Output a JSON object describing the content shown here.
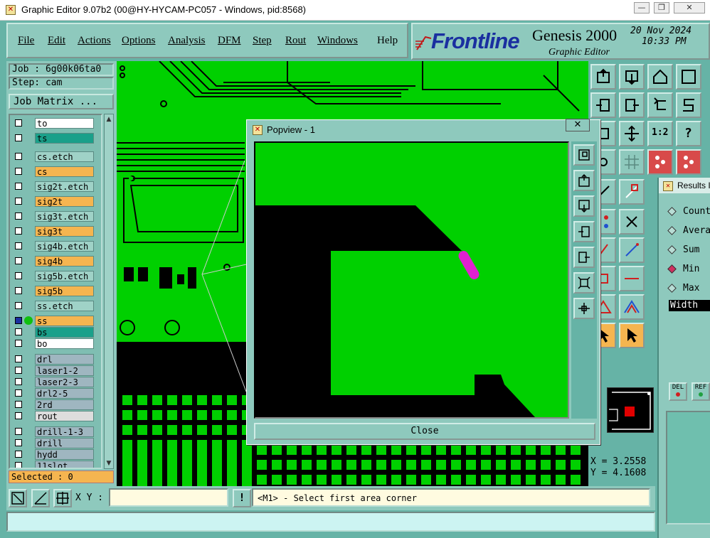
{
  "window": {
    "title": "Graphic Editor 9.07b2 (00@HY-HYCAM-PC057 - Windows, pid:8568)",
    "min_glyph": "—",
    "max_glyph": "❐",
    "close_glyph": "✕"
  },
  "menu": {
    "file": "File",
    "edit": "Edit",
    "actions": "Actions",
    "options": "Options",
    "analysis": "Analysis",
    "dfm": "DFM",
    "step": "Step",
    "rout": "Rout",
    "windows": "Windows",
    "help": "Help"
  },
  "banner": {
    "logo": "Frontline",
    "product": "Genesis 2000",
    "subtitle": "Graphic Editor",
    "date": "20 Nov 2024",
    "time": "10:33 PM"
  },
  "job": {
    "job_line": "Job : 6g00k06ta0",
    "step_line": "Step: cam",
    "job_matrix_label": "Job Matrix ..."
  },
  "layers": [
    {
      "name": "to",
      "color": "#ffffff"
    },
    {
      "name": "ts",
      "color": "#1aa08a"
    },
    {
      "name": "cs.etch",
      "color": "#9fd2c7"
    },
    {
      "name": "cs",
      "color": "#f5b550"
    },
    {
      "name": "sig2t.etch",
      "color": "#9fd2c7"
    },
    {
      "name": "sig2t",
      "color": "#f5b550"
    },
    {
      "name": "sig3t.etch",
      "color": "#9fd2c7"
    },
    {
      "name": "sig3t",
      "color": "#f5b550"
    },
    {
      "name": "sig4b.etch",
      "color": "#9fd2c7"
    },
    {
      "name": "sig4b",
      "color": "#f5b550"
    },
    {
      "name": "sig5b.etch",
      "color": "#9fd2c7"
    },
    {
      "name": "sig5b",
      "color": "#f5b550"
    },
    {
      "name": "ss.etch",
      "color": "#9fd2c7"
    },
    {
      "name": "ss",
      "color": "#f5b550",
      "active": true
    },
    {
      "name": "bs",
      "color": "#1aa08a"
    },
    {
      "name": "bo",
      "color": "#ffffff"
    },
    {
      "name": "drl",
      "color": "#9fb6c0"
    },
    {
      "name": "laser1-2",
      "color": "#9fb6c0"
    },
    {
      "name": "laser2-3",
      "color": "#9fb6c0"
    },
    {
      "name": "drl2-5",
      "color": "#9fb6c0"
    },
    {
      "name": "2rd",
      "color": "#9fb6c0"
    },
    {
      "name": "rout",
      "color": "#dddddd"
    },
    {
      "name": "drill-1-3",
      "color": "#9fb6c0"
    },
    {
      "name": "drill",
      "color": "#9fb6c0"
    },
    {
      "name": "hydd",
      "color": "#9fb6c0"
    },
    {
      "name": "11slot",
      "color": "#9fb6c0"
    }
  ],
  "selected_label": "Selected : 0",
  "coords": {
    "x": "X = 3.2558",
    "y": "Y = 4.1608"
  },
  "results": {
    "title": "Results I",
    "options": [
      "Count",
      "Avera",
      "Sum",
      "Min",
      "Max"
    ],
    "selected": "Min",
    "field": "Width",
    "del_label": "DEL",
    "ref_label": "REF"
  },
  "bottom": {
    "xy_label": "X Y :",
    "xy_value": "",
    "warn_glyph": "!",
    "prompt": "<M1> - Select first area corner"
  },
  "popview": {
    "title": "Popview - 1",
    "close_glyph": "✕",
    "close_button": "Close"
  },
  "tool_texts": {
    "zoom_one": "1:2",
    "help": "?"
  },
  "colors": {
    "copper": "#00d000",
    "board": "#000000",
    "panel": "#8ec9bd",
    "highlight": "#e020d0",
    "layer_active": "#f5b550"
  }
}
